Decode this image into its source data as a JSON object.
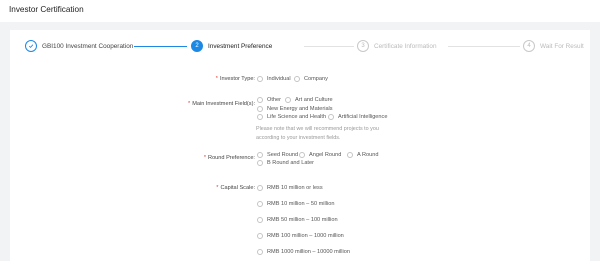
{
  "header": {
    "title": "Investor Certification"
  },
  "steps": [
    {
      "index": "✓",
      "label": "GBI100 Investment Cooperation",
      "state": "done"
    },
    {
      "index": "2",
      "label": "Investment Preference",
      "state": "active"
    },
    {
      "index": "3",
      "label": "Certificate Information",
      "state": "todo"
    },
    {
      "index": "4",
      "label": "Wait For Result",
      "state": "todo"
    }
  ],
  "form": {
    "investor_type": {
      "label": "Investor Type:",
      "options": [
        "Individual",
        "Company"
      ]
    },
    "main_fields": {
      "label": "Main Investment Field(s):",
      "options": [
        "Other",
        "Art and Culture",
        "New Energy and Materials",
        "Life Science and Health",
        "Artificial Intelligence"
      ],
      "note": "Please note that we will recommend projects to you according to your investment fields."
    },
    "round_preference": {
      "label": "Round Preference:",
      "options": [
        "Seed Round",
        "Angel Round",
        "A Round",
        "B Round and Later"
      ]
    },
    "capital_scale": {
      "label": "Capital Scale:",
      "options": [
        "RMB 10 million or less",
        "RMB 10 million – 50 million",
        "RMB 50 million – 100 million",
        "RMB 100 million – 1000 million",
        "RMB 1000 million – 10000 million"
      ]
    }
  },
  "colors": {
    "accent": "#1e88e5",
    "required": "#e53935",
    "background": "#f2f3f5"
  }
}
